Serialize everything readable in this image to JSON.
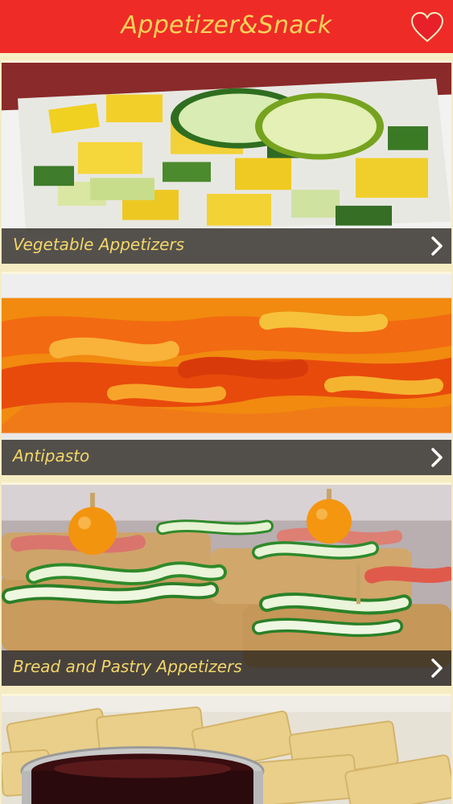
{
  "header": {
    "title": "Appetizer&Snack",
    "favorite_icon": "heart-icon",
    "background_color": "#ef2b27",
    "title_color": "#f6d35a"
  },
  "categories": [
    {
      "label": "Vegetable Appetizers",
      "icon": "chevron-right-icon"
    },
    {
      "label": "Antipasto",
      "icon": "chevron-right-icon"
    },
    {
      "label": "Bread and Pastry Appetizers",
      "icon": "chevron-right-icon"
    },
    {
      "label": ""
    }
  ],
  "colors": {
    "caption_text": "#f3d66a",
    "page_background": "#f6ecc3"
  }
}
